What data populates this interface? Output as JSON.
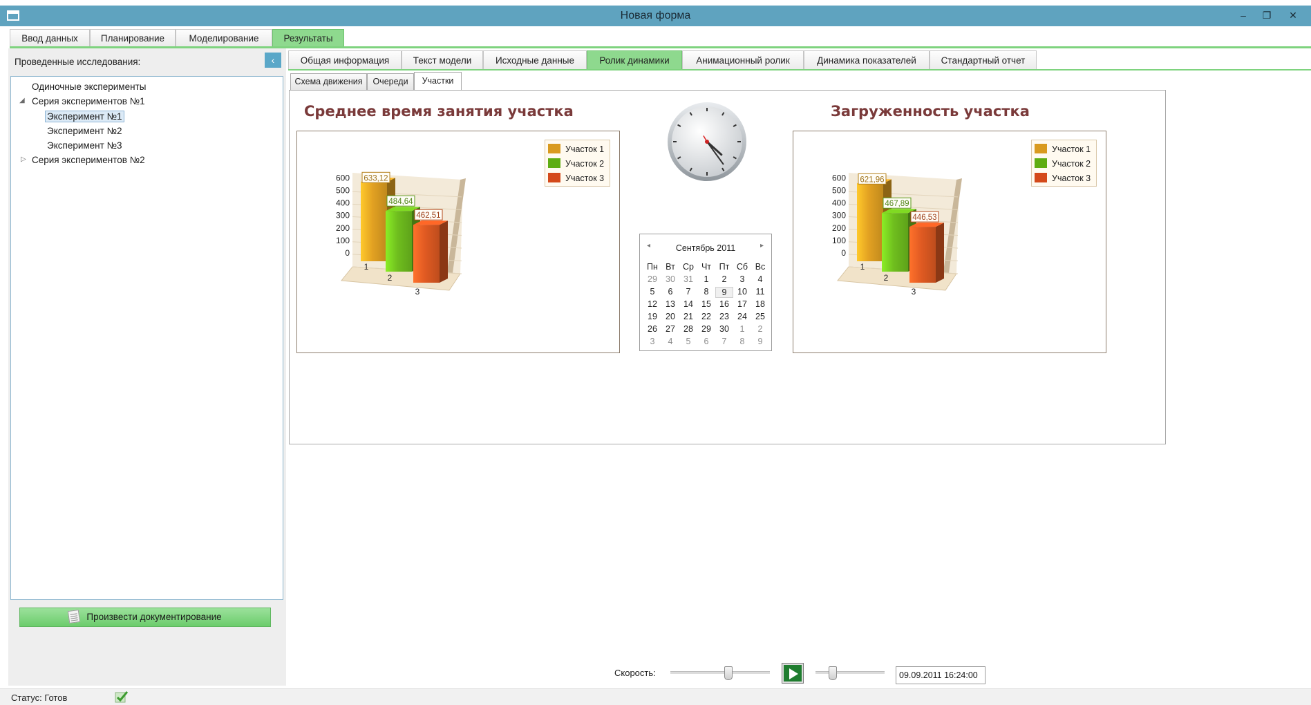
{
  "window": {
    "title": "Новая форма",
    "minimize_glyph": "–",
    "restore_glyph": "❐",
    "close_glyph": "✕"
  },
  "main_tabs": [
    {
      "label": "Ввод данных",
      "active": false
    },
    {
      "label": "Планирование",
      "active": false
    },
    {
      "label": "Моделирование",
      "active": false
    },
    {
      "label": "Результаты",
      "active": true
    }
  ],
  "left_panel": {
    "header": "Проведенные исследования:",
    "collapse_glyph": "‹",
    "tree": [
      {
        "label": "Одиночные эксперименты",
        "level": 1,
        "expander": ""
      },
      {
        "label": "Серия экспериментов №1",
        "level": 1,
        "expander": "expanded"
      },
      {
        "label": "Эксперимент №1",
        "level": 2,
        "selected": true
      },
      {
        "label": "Эксперимент №2",
        "level": 2
      },
      {
        "label": "Эксперимент №3",
        "level": 2
      },
      {
        "label": "Серия экспериментов №2",
        "level": 1,
        "expander": "collapsed"
      }
    ],
    "doc_button": "Произвести документирование"
  },
  "sub_tabs": [
    {
      "label": "Общая информация",
      "active": false
    },
    {
      "label": "Текст модели",
      "active": false
    },
    {
      "label": "Исходные данные",
      "active": false
    },
    {
      "label": "Ролик динамики",
      "active": true
    },
    {
      "label": "Анимационный ролик",
      "active": false
    },
    {
      "label": "Динамика показателей",
      "active": false
    },
    {
      "label": "Стандартный отчет",
      "active": false
    }
  ],
  "inner_tabs": [
    {
      "label": "Схема движения",
      "active": false
    },
    {
      "label": "Очереди",
      "active": false
    },
    {
      "label": "Участки",
      "active": true
    }
  ],
  "colors": {
    "series1": "#e2a122",
    "series2": "#6fbe1e",
    "series3": "#e05a22",
    "accent_green": "#8ed98e",
    "chart_title": "#7a3a3a"
  },
  "chart_data": [
    {
      "type": "bar",
      "title": "Среднее время занятия участка",
      "categories": [
        "1",
        "2",
        "3"
      ],
      "series": [
        {
          "name": "Участок 1",
          "values": [
            633.12
          ]
        },
        {
          "name": "Участок 2",
          "values": [
            484.64
          ]
        },
        {
          "name": "Участок 3",
          "values": [
            462.51
          ]
        }
      ],
      "data_labels": [
        "633,12",
        "484,64",
        "462,51"
      ],
      "y_ticks": [
        "0",
        "100",
        "200",
        "300",
        "400",
        "500",
        "600"
      ],
      "ylim": [
        0,
        680
      ],
      "legend": "top-right",
      "style": "3d"
    },
    {
      "type": "bar",
      "title": "Загруженность участка",
      "categories": [
        "1",
        "2",
        "3"
      ],
      "series": [
        {
          "name": "Участок 1",
          "values": [
            621.96
          ]
        },
        {
          "name": "Участок 2",
          "values": [
            467.89
          ]
        },
        {
          "name": "Участок 3",
          "values": [
            446.53
          ]
        }
      ],
      "data_labels": [
        "621,96",
        "467,89",
        "446,53"
      ],
      "y_ticks": [
        "0",
        "100",
        "200",
        "300",
        "400",
        "500",
        "600"
      ],
      "ylim": [
        0,
        680
      ],
      "legend": "top-right",
      "style": "3d"
    }
  ],
  "clock": {
    "hour": 16,
    "minute": 24,
    "second": 0
  },
  "calendar": {
    "header": "Сентябрь 2011",
    "prev_glyph": "◂",
    "next_glyph": "▸",
    "days_of_week": [
      "Пн",
      "Вт",
      "Ср",
      "Чт",
      "Пт",
      "Сб",
      "Вс"
    ],
    "weeks": [
      [
        "29",
        "30",
        "31",
        "1",
        "2",
        "3",
        "4"
      ],
      [
        "5",
        "6",
        "7",
        "8",
        "9",
        "10",
        "11"
      ],
      [
        "12",
        "13",
        "14",
        "15",
        "16",
        "17",
        "18"
      ],
      [
        "19",
        "20",
        "21",
        "22",
        "23",
        "24",
        "25"
      ],
      [
        "26",
        "27",
        "28",
        "29",
        "30",
        "1",
        "2"
      ],
      [
        "3",
        "4",
        "5",
        "6",
        "7",
        "8",
        "9"
      ]
    ],
    "today": "9"
  },
  "controls": {
    "speed_label": "Скорость:",
    "speed_value": 0.58,
    "position_value": 0.25,
    "datetime": "09.09.2011 16:24:00"
  },
  "status": {
    "text": "Статус: Готов"
  }
}
